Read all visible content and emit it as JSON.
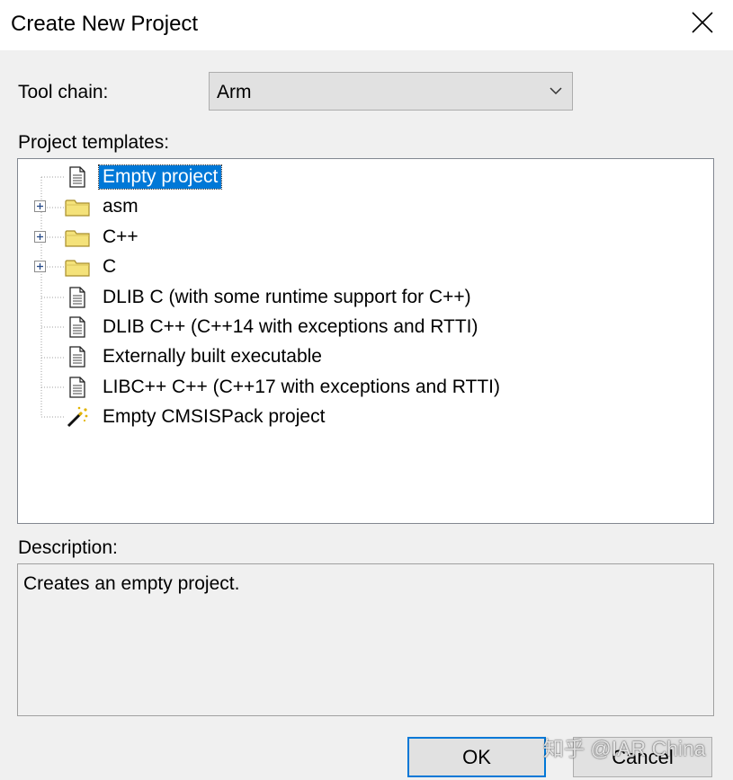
{
  "window": {
    "title": "Create New Project",
    "close_icon": "close-icon"
  },
  "toolchain": {
    "label": "Tool chain:",
    "selected": "Arm"
  },
  "templates": {
    "label": "Project templates:",
    "items": [
      {
        "label": "Empty project",
        "icon": "document-icon",
        "expandable": false,
        "selected": true
      },
      {
        "label": "asm",
        "icon": "folder-icon",
        "expandable": true,
        "selected": false
      },
      {
        "label": "C++",
        "icon": "folder-icon",
        "expandable": true,
        "selected": false
      },
      {
        "label": "C",
        "icon": "folder-icon",
        "expandable": true,
        "selected": false
      },
      {
        "label": "DLIB C (with some runtime support for C++)",
        "icon": "document-icon",
        "expandable": false,
        "selected": false
      },
      {
        "label": "DLIB C++ (C++14 with exceptions and RTTI)",
        "icon": "document-icon",
        "expandable": false,
        "selected": false
      },
      {
        "label": "Externally built executable",
        "icon": "document-icon",
        "expandable": false,
        "selected": false
      },
      {
        "label": "LIBC++ C++ (C++17 with exceptions and RTTI)",
        "icon": "document-icon",
        "expandable": false,
        "selected": false
      },
      {
        "label": "Empty CMSISPack project",
        "icon": "magic-wand-icon",
        "expandable": false,
        "selected": false
      }
    ]
  },
  "description": {
    "label": "Description:",
    "text": "Creates an empty project."
  },
  "buttons": {
    "ok": "OK",
    "cancel": "Cancel"
  },
  "watermark": "知乎 @IAR China",
  "colors": {
    "selection": "#0078d7",
    "folder": "#f4e27a",
    "dialog_bg": "#f0f0f0"
  }
}
